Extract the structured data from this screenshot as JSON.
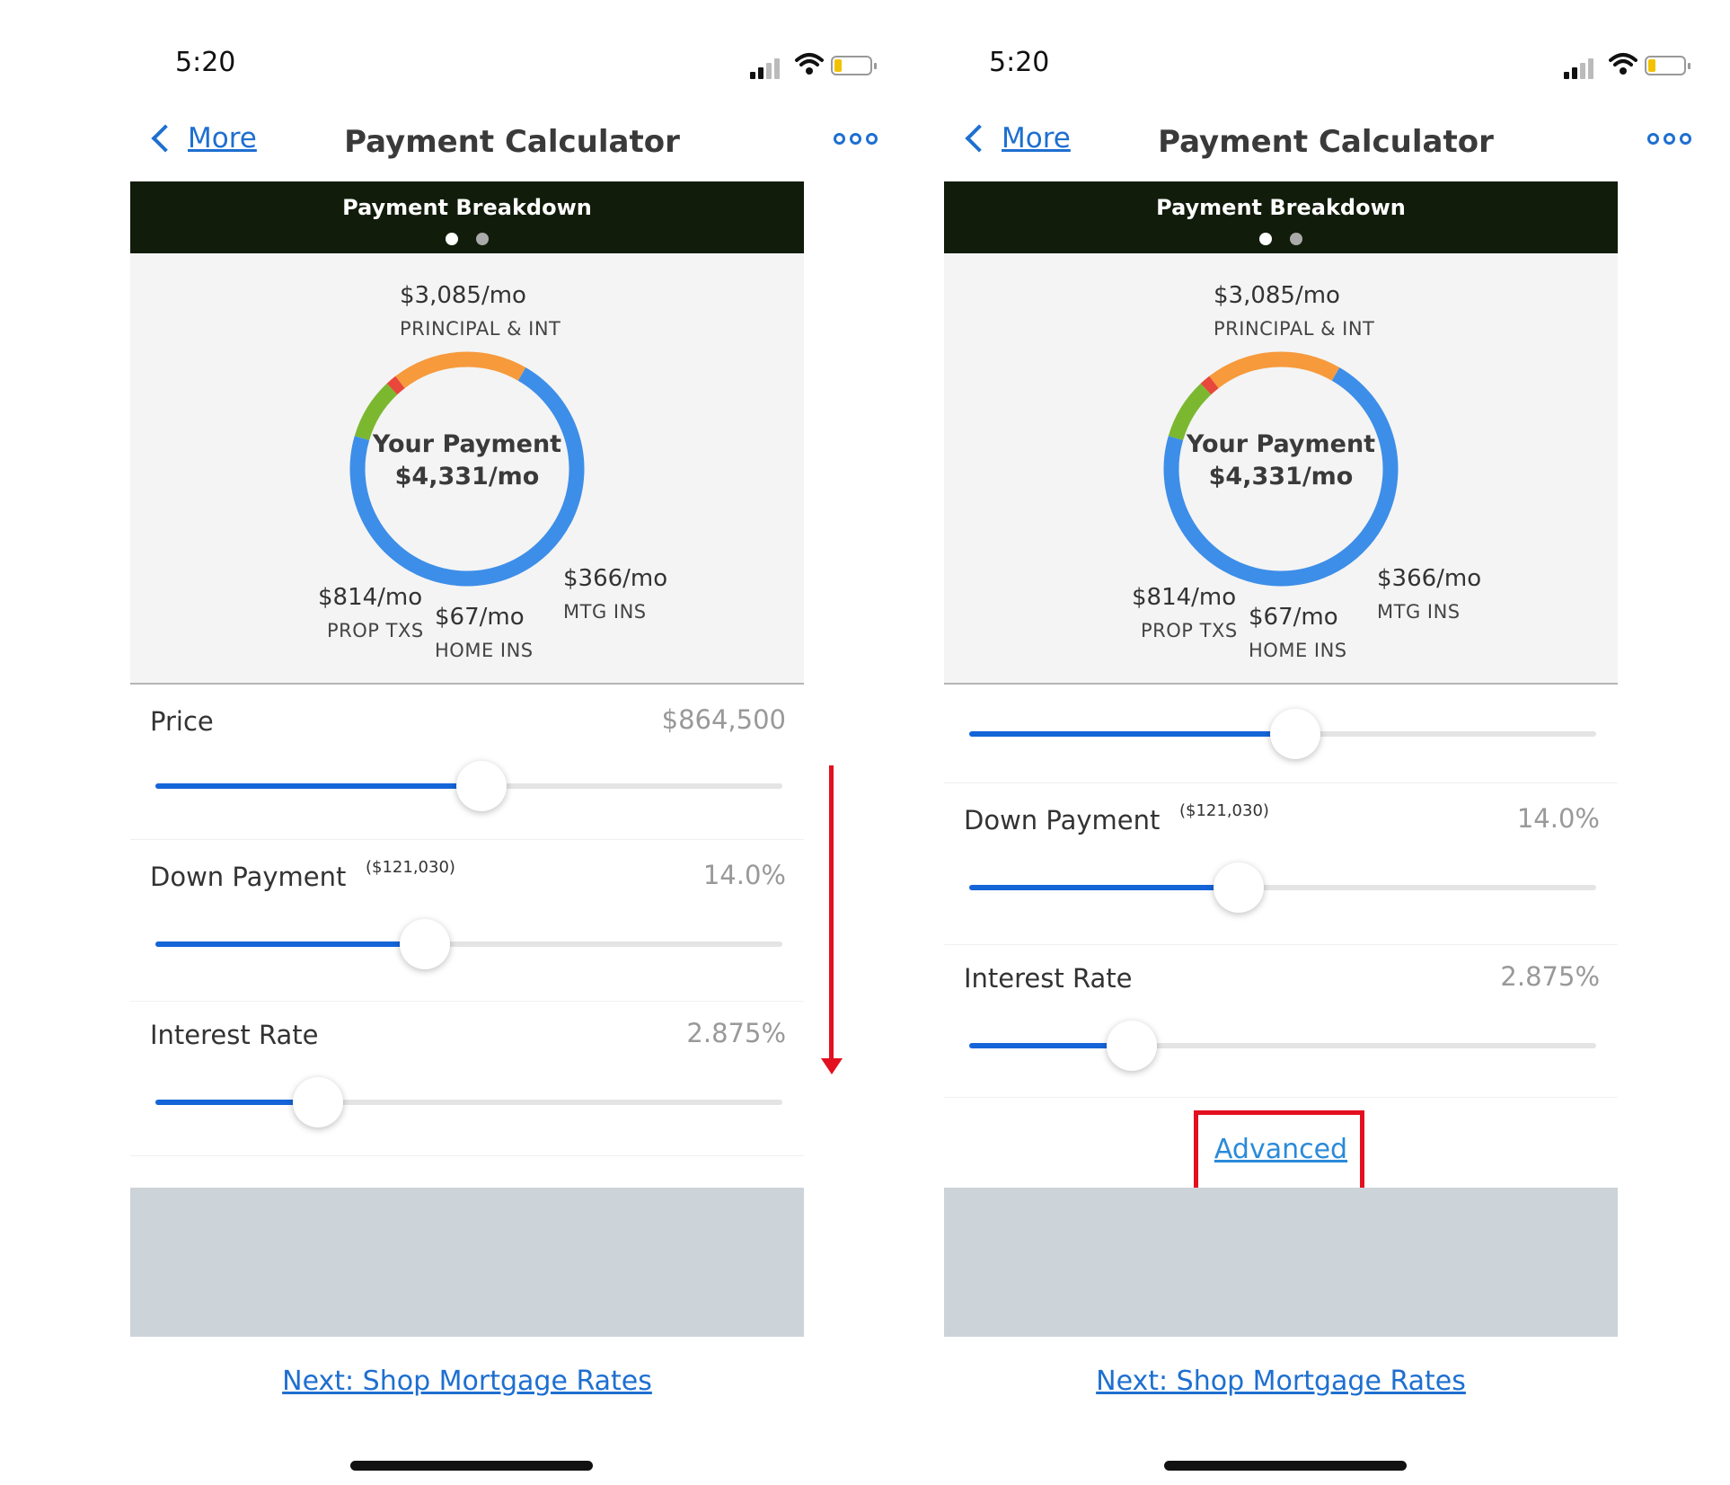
{
  "status": {
    "time": "5:20"
  },
  "nav": {
    "back_label": "More",
    "title": "Payment Calculator"
  },
  "breakdown": {
    "title": "Payment Breakdown",
    "center_title": "Your Payment",
    "center_value": "$4,331/mo",
    "principal_value": "$3,085/mo",
    "principal_caption": "PRINCIPAL & INT",
    "prop_value": "$814/mo",
    "prop_caption": "PROP TXS",
    "home_value": "$67/mo",
    "home_caption": "HOME INS",
    "mtg_value": "$366/mo",
    "mtg_caption": "MTG INS",
    "segment_values": [
      3085,
      814,
      67,
      366
    ],
    "segment_colors": [
      "#3d8ee8",
      "#f69a3c",
      "#e8473b",
      "#7bb830"
    ]
  },
  "fields": {
    "price_label": "Price",
    "price_value": "$864,500",
    "price_fraction": 0.52,
    "down_label": "Down Payment",
    "down_sub": "($121,030)",
    "down_value": "14.0%",
    "down_fraction": 0.43,
    "rate_label": "Interest Rate",
    "rate_value": "2.875%",
    "rate_fraction": 0.26
  },
  "advanced_label": "Advanced",
  "next_label": "Next: Shop Mortgage Rates",
  "colors": {
    "accent": "#1e6fd0",
    "highlight": "#e3101f",
    "header_bg": "#121c0a"
  }
}
